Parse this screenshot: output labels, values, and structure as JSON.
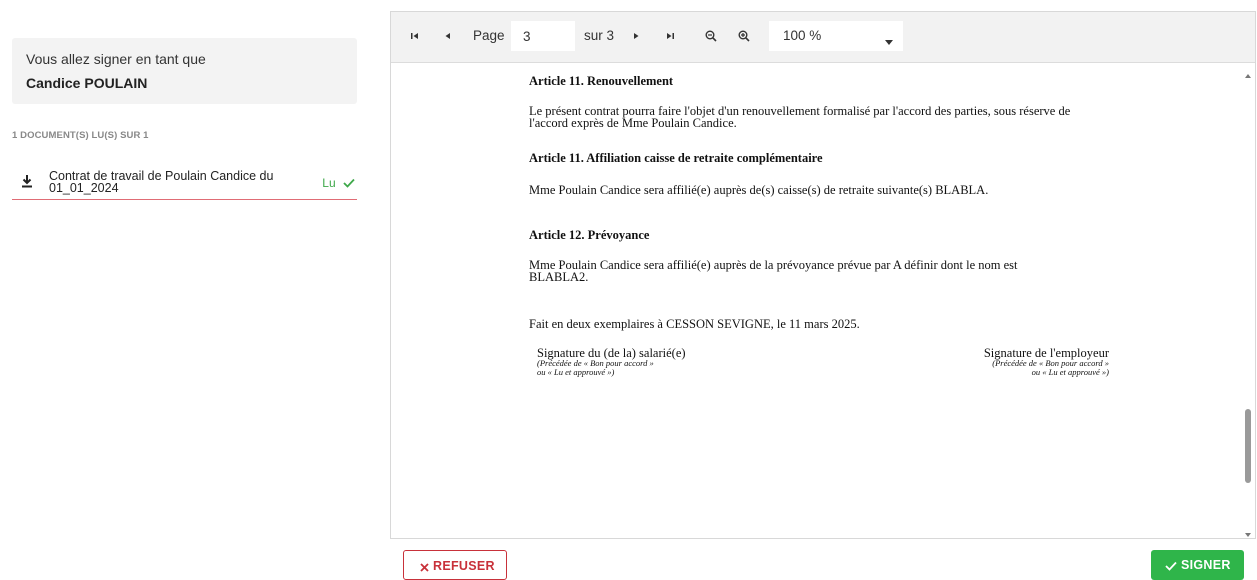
{
  "signer": {
    "intro": "Vous allez signer en tant que",
    "name": "Candice POULAIN"
  },
  "documents": {
    "count_label": "1 DOCUMENT(S) LU(S) SUR 1",
    "items": [
      {
        "title": "Contrat de travail de Poulain Candice du 01_01_2024",
        "status": "Lu",
        "icon": "download-icon",
        "status_icon": "check-icon",
        "status_color": "#3ea84a"
      }
    ]
  },
  "viewer": {
    "toolbar": {
      "page_label": "Page",
      "page_value": "3",
      "total_label": "sur 3",
      "zoom_value": "100 %",
      "icons": [
        "first-page-icon",
        "prev-page-icon",
        "next-page-icon",
        "last-page-icon",
        "zoom-out-icon",
        "zoom-in-icon",
        "dropdown-caret-icon"
      ]
    },
    "document": {
      "art11a_title": "Article 11. Renouvellement",
      "art11a_l1": "Le présent contrat pourra faire l'objet d'un renouvellement formalisé par l'accord des parties, sous réserve de",
      "art11a_l2": "l'accord exprès de Mme Poulain Candice.",
      "art11b_title": "Article 11. Affiliation caisse de retraite complémentaire",
      "art11b_l1": "Mme Poulain Candice sera affilié(e) auprès de(s) caisse(s) de retraite  suivante(s) BLABLA.",
      "art12_title": "Article 12. Prévoyance",
      "art12_l1": "Mme Poulain Candice sera affilié(e) auprès de la prévoyance prévue par A définir dont le nom est",
      "art12_l2": "BLABLA2.",
      "closing": "Fait en deux exemplaires à CESSON SEVIGNE, le 11 mars 2025.",
      "sig_employee": "Signature du (de la) salarié(e)",
      "sig_employee_note1": "(Précédée de « Bon pour accord »",
      "sig_employee_note2": "ou « Lu et approuvé »)",
      "sig_employer": "Signature de l'employeur",
      "sig_employer_note1": "(Précédée de « Bon pour accord »",
      "sig_employer_note2": "ou « Lu et approuvé »)"
    }
  },
  "actions": {
    "refuse_label": "REFUSER",
    "sign_label": "SIGNER",
    "refuse_color": "#c8313a",
    "sign_color": "#2fb54a"
  }
}
